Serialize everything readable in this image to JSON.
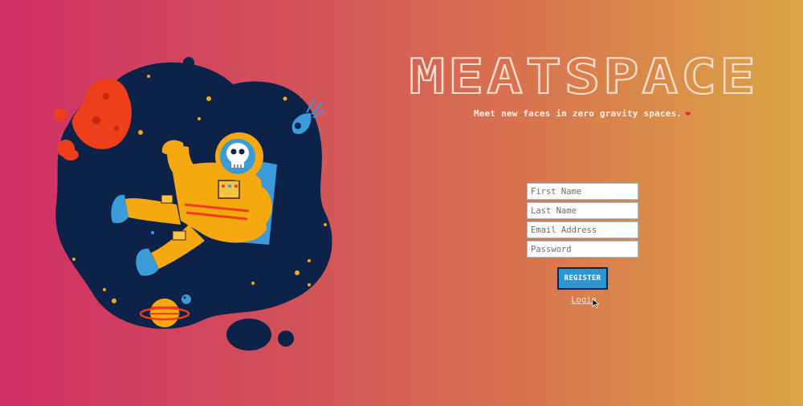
{
  "app": {
    "title": "MEATSPACE",
    "tagline": "Meet new faces in zero gravity spaces.",
    "tagline_emoji": "❤"
  },
  "form": {
    "first_name_placeholder": "First Name",
    "last_name_placeholder": "Last Name",
    "email_placeholder": "Email Address",
    "password_placeholder": "Password",
    "register_label": "REGISTER",
    "login_label": "Login"
  },
  "colors": {
    "gradient_start": "#d02f66",
    "gradient_end": "#dba645",
    "space_blob": "#0d2249",
    "astronaut_suit": "#f5a80f",
    "planet_red": "#ee3e1a",
    "register_button": "#2d96d1"
  },
  "icons": {
    "illustration": "astronaut-floating-in-space-illustration",
    "cursor": "mouse-pointer-icon"
  }
}
